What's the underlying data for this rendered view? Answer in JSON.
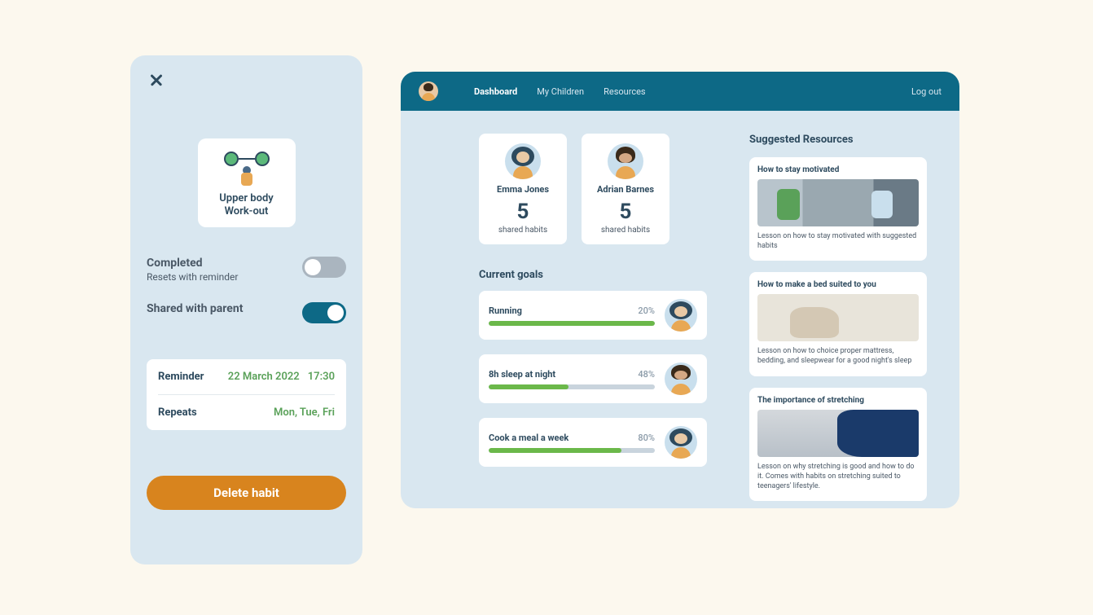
{
  "mobile": {
    "habit": {
      "title_line1": "Upper body",
      "title_line2": "Work-out"
    },
    "completed": {
      "label": "Completed",
      "sub": "Resets with reminder",
      "on": false
    },
    "shared": {
      "label": "Shared with parent",
      "on": true
    },
    "reminder": {
      "label": "Reminder",
      "date": "22 March 2022",
      "time": "17:30"
    },
    "repeats": {
      "label": "Repeats",
      "value": "Mon, Tue, Fri"
    },
    "delete_label": "Delete habit"
  },
  "topbar": {
    "links": [
      {
        "label": "Dashboard",
        "active": true
      },
      {
        "label": "My Children",
        "active": false
      },
      {
        "label": "Resources",
        "active": false
      }
    ],
    "logout": "Log out"
  },
  "children": [
    {
      "name": "Emma Jones",
      "count": "5",
      "caption": "shared habits",
      "avatar": "emma"
    },
    {
      "name": "Adrian Barnes",
      "count": "5",
      "caption": "shared habits",
      "avatar": "adrian"
    }
  ],
  "goals_title": "Current goals",
  "goals": [
    {
      "name": "Running",
      "pct": "20%",
      "width": "20%",
      "avatar": "emma"
    },
    {
      "name": "8h sleep at night",
      "pct": "48%",
      "width": "48%",
      "avatar": "adrian"
    },
    {
      "name": "Cook a meal a week",
      "pct": "80%",
      "width": "80%",
      "avatar": "emma"
    }
  ],
  "resources_title": "Suggested Resources",
  "resources": [
    {
      "heading": "How to stay motivated",
      "desc": "Lesson on how to stay motivated with suggested habits"
    },
    {
      "heading": "How to make a bed suited to you",
      "desc": "Lesson on how to choice proper mattress, bedding, and sleepwear for a good night's sleep"
    },
    {
      "heading": "The importance of stretching",
      "desc": "Lesson on why stretching is good and how to do it. Comes with habits on stretching suited to teenagers' lifestyle."
    }
  ]
}
